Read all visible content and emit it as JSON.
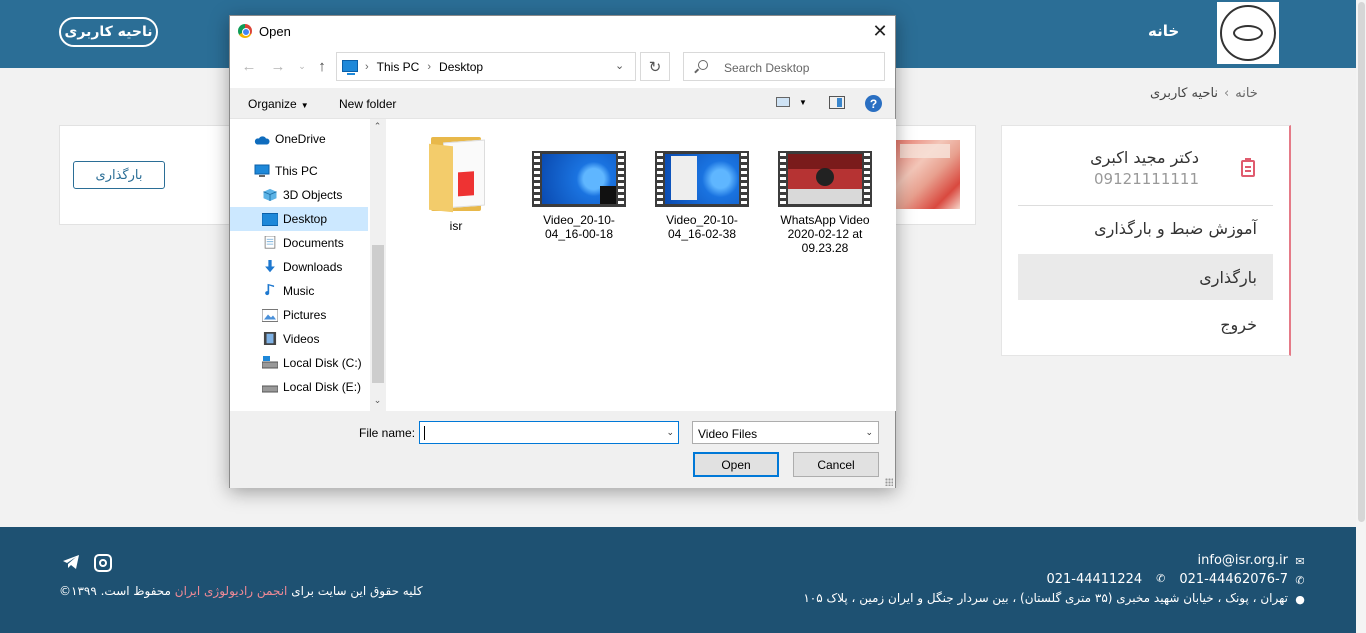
{
  "site": {
    "header": {
      "user_area_button": "ناحیه کاربری",
      "home_link": "خانه"
    },
    "breadcrumb": {
      "home": "خانه",
      "separator": "›",
      "current": "ناحیه کاربری"
    },
    "main": {
      "upload_button": "بارگذاری"
    },
    "sidebar": {
      "name": "دکتر مجید اکبری",
      "phone": "09121111111",
      "items": [
        {
          "label": "آموزش ضبط و بارگذاری",
          "active": false
        },
        {
          "label": "بارگذاری",
          "active": true
        },
        {
          "label": "خروج",
          "active": false
        }
      ]
    },
    "footer": {
      "email": "info@isr.org.ir",
      "phone1": "021-44462076-7",
      "phone2": "021-44411224",
      "address": "تهران ، پونک ، خیابان شهید مخبری (۳۵ متری گلستان) ، بین سردار جنگل و ایران زمین ، پلاک ۱۰۵",
      "copyright_pre": "کلیه حقوق این سایت برای",
      "copyright_org": "انجمن رادیولوژی ایران",
      "copyright_post": "محفوظ است. ۱۳۹۹©"
    }
  },
  "dialog": {
    "title": "Open",
    "address": {
      "root": "This PC",
      "folder": "Desktop"
    },
    "search_placeholder": "Search Desktop",
    "toolbar": {
      "organize": "Organize",
      "new_folder": "New folder",
      "help": "?"
    },
    "nav_items": [
      {
        "label": "OneDrive",
        "icon": "cloud-icon",
        "selected": false
      },
      {
        "label": "This PC",
        "icon": "computer-icon",
        "selected": false
      },
      {
        "label": "3D Objects",
        "icon": "cube-icon",
        "selected": false
      },
      {
        "label": "Desktop",
        "icon": "desktop-icon",
        "selected": true
      },
      {
        "label": "Documents",
        "icon": "document-icon",
        "selected": false
      },
      {
        "label": "Downloads",
        "icon": "download-icon",
        "selected": false
      },
      {
        "label": "Music",
        "icon": "music-icon",
        "selected": false
      },
      {
        "label": "Pictures",
        "icon": "picture-icon",
        "selected": false
      },
      {
        "label": "Videos",
        "icon": "video-icon",
        "selected": false
      },
      {
        "label": "Local Disk (C:)",
        "icon": "drive-icon",
        "selected": false
      },
      {
        "label": "Local Disk (E:)",
        "icon": "drive-icon",
        "selected": false
      }
    ],
    "files": [
      {
        "name": "isr",
        "type": "folder"
      },
      {
        "name": "Video_20-10-04_16-00-18",
        "type": "video"
      },
      {
        "name": "Video_20-10-04_16-02-38",
        "type": "video"
      },
      {
        "name": "WhatsApp Video 2020-02-12 at 09.23.28",
        "type": "video"
      }
    ],
    "file_name_label": "File name:",
    "file_name_value": "",
    "file_type": "Video Files",
    "open_button": "Open",
    "cancel_button": "Cancel"
  },
  "colors": {
    "header": "#2b6e96",
    "footer": "#1e5172",
    "accent_pink": "#e05b6e",
    "selection": "#cce8ff"
  }
}
